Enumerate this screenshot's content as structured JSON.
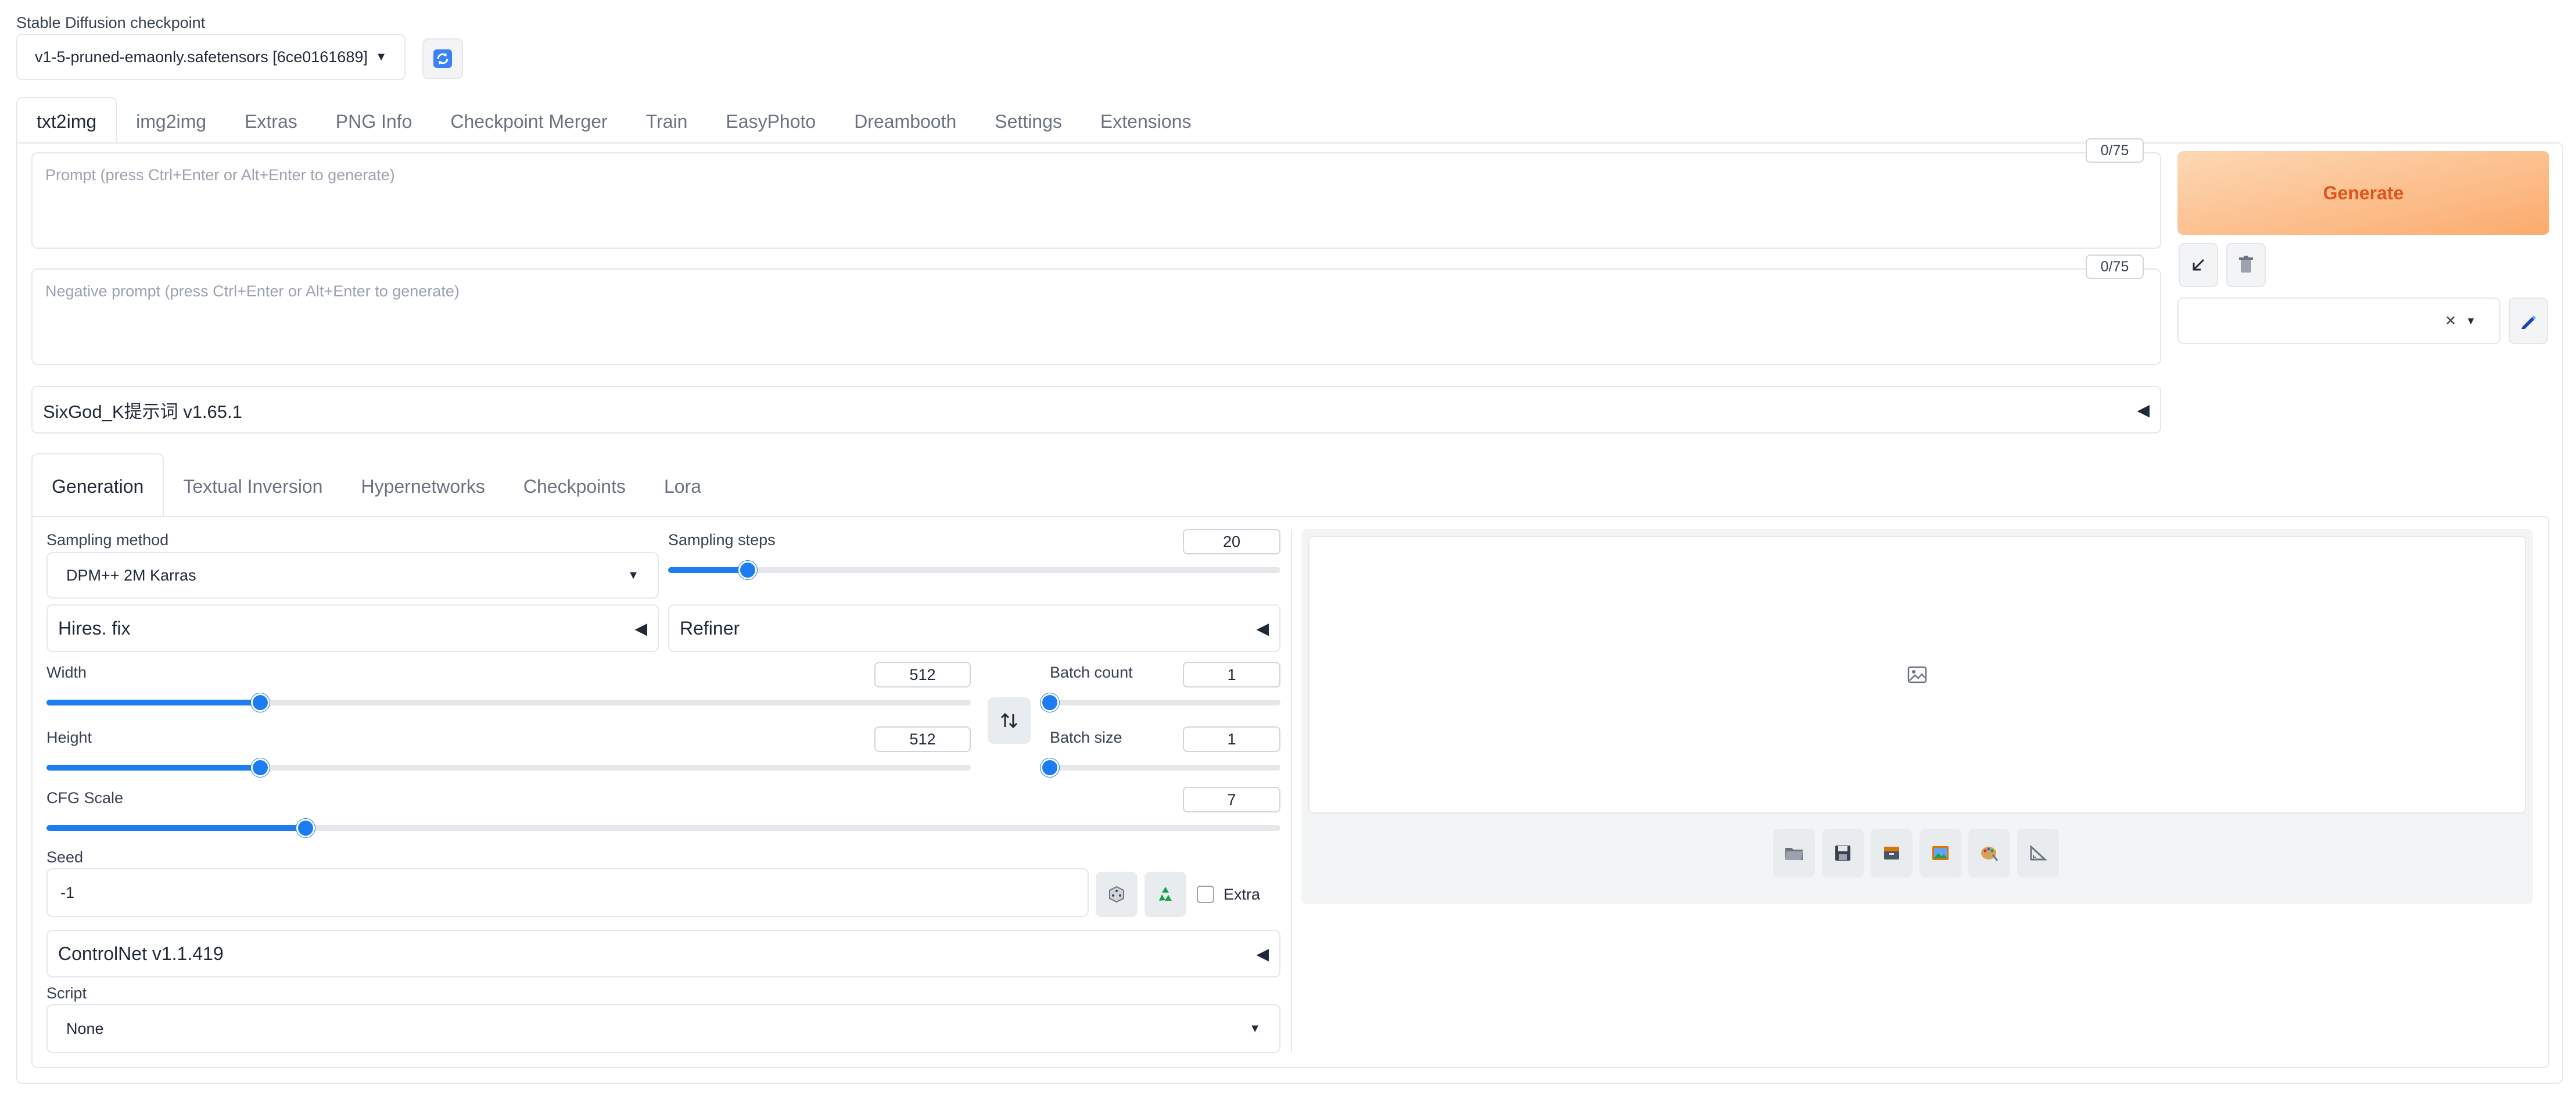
{
  "checkpoint": {
    "label": "Stable Diffusion checkpoint",
    "value": "v1-5-pruned-emaonly.safetensors [6ce0161689]"
  },
  "main_tabs": [
    "txt2img",
    "img2img",
    "Extras",
    "PNG Info",
    "Checkpoint Merger",
    "Train",
    "EasyPhoto",
    "Dreambooth",
    "Settings",
    "Extensions"
  ],
  "prompt": {
    "placeholder": "Prompt (press Ctrl+Enter or Alt+Enter to generate)",
    "counter": "0/75"
  },
  "negative_prompt": {
    "placeholder": "Negative prompt (press Ctrl+Enter or Alt+Enter to generate)",
    "counter": "0/75"
  },
  "generate_label": "Generate",
  "sixgod_label": "SixGod_K提示词 v1.65.1",
  "sub_tabs": [
    "Generation",
    "Textual Inversion",
    "Hypernetworks",
    "Checkpoints",
    "Lora"
  ],
  "sampling": {
    "method_label": "Sampling method",
    "method_value": "DPM++ 2M Karras",
    "steps_label": "Sampling steps",
    "steps_value": "20",
    "steps_fraction": 0.13
  },
  "hires_label": "Hires. fix",
  "refiner_label": "Refiner",
  "width": {
    "label": "Width",
    "value": "512",
    "fraction": 0.231
  },
  "height": {
    "label": "Height",
    "value": "512",
    "fraction": 0.231
  },
  "batch_count": {
    "label": "Batch count",
    "value": "1",
    "fraction": 0
  },
  "batch_size": {
    "label": "Batch size",
    "value": "1",
    "fraction": 0
  },
  "cfg": {
    "label": "CFG Scale",
    "value": "7",
    "fraction": 0.21
  },
  "seed": {
    "label": "Seed",
    "value": "-1",
    "extra_label": "Extra"
  },
  "controlnet_label": "ControlNet v1.1.419",
  "script": {
    "label": "Script",
    "value": "None"
  },
  "colors": {
    "accent": "#1d7df0",
    "generate_text": "#e2541a",
    "generate_bg_start": "#fdd8b5",
    "generate_bg_end": "#fbab6d"
  }
}
